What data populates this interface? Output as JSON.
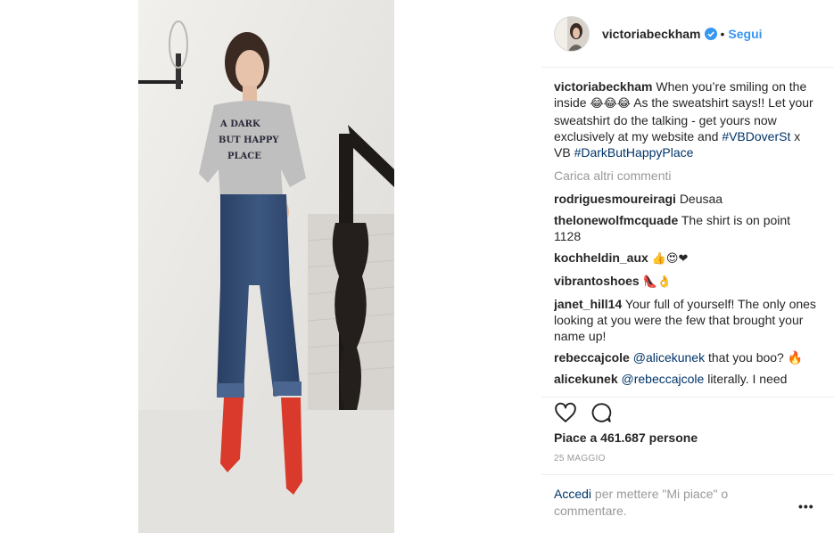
{
  "post": {
    "username": "victoriabeckham",
    "follow_label": "Segui",
    "separator_dot": "•",
    "caption": {
      "user": "victoriabeckham",
      "text_1": "When you’re smiling on the inside",
      "emoji_1": "😂😂😂",
      "text_2": "As the sweatshirt says!! Let your sweatshirt do the talking - get yours now exclusively at my website and",
      "hashtag_1": "#VBDoverSt",
      "text_3": "x VB",
      "hashtag_2": "#DarkButHappyPlace"
    },
    "load_more_label": "Carica altri commenti",
    "comments": [
      {
        "user": "rodriguesmoureiragi",
        "text": "Deusaa"
      },
      {
        "user": "thelonewolfmcquade",
        "text": "The shirt is on point 1128"
      },
      {
        "user": "kochheldin_aux",
        "text": "👍😍❤"
      },
      {
        "user": "vibrantoshoes",
        "text": "👠👌"
      },
      {
        "user": "janet_hill14",
        "text": "Your full of yourself! The only ones looking at you were the few that brought your name up!"
      },
      {
        "user": "rebeccajcole",
        "mention": "@alicekunek",
        "text": "that you boo? 🔥"
      },
      {
        "user": "alicekunek",
        "mention": "@rebeccajcole",
        "text": "literally. I need"
      }
    ],
    "likes_label": "Piace a 461.687 persone",
    "date_label": "25 MAGGIO",
    "login_link": "Accedi",
    "login_text": "per mettere \"Mi piace\" o commentare.",
    "more_options": "•••"
  },
  "colors": {
    "link": "#3897f0",
    "hashtag": "#003569",
    "muted": "#999999",
    "text": "#262626"
  },
  "icons": [
    "verified-badge-icon",
    "heart-icon",
    "comment-icon",
    "more-options-icon"
  ]
}
